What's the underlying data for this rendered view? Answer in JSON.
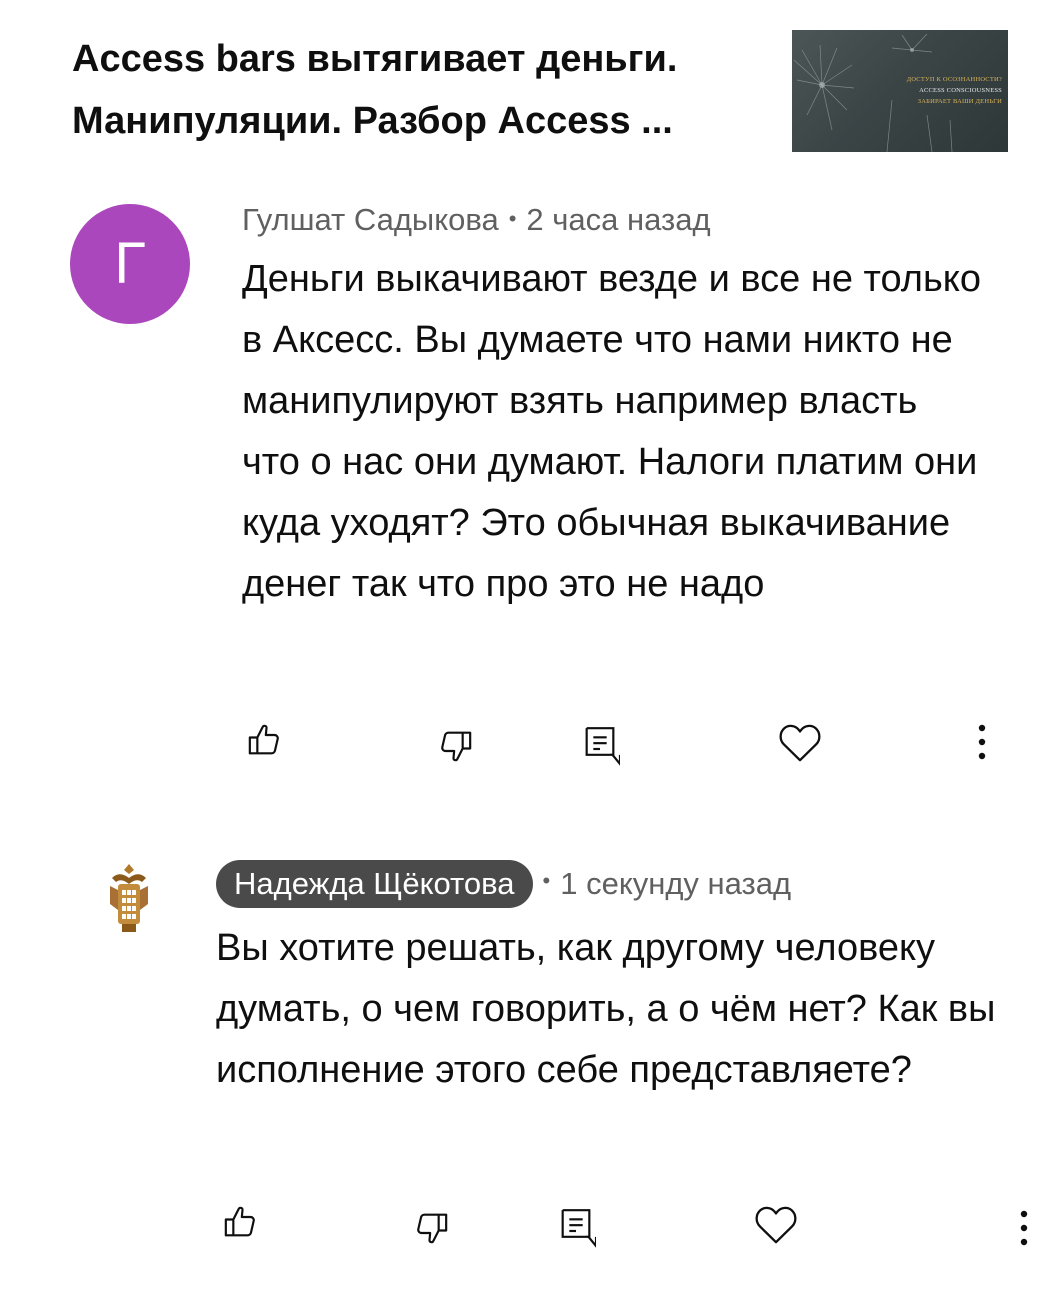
{
  "video": {
    "title": "Access bars вытягивает деньги. Манипуляции. Разбор Access ...",
    "thumbnail": {
      "line1": "ДОСТУП К ОСОЗНАННОСТИ?",
      "line2": "ACCESS CONSCIOUSNESS",
      "line3": "ЗАБИРАЕТ ВАШИ ДЕНЬГИ"
    }
  },
  "comments": [
    {
      "avatar_letter": "Г",
      "avatar_color": "#ab47bc",
      "author": "Гулшат Садыкова",
      "separator": "•",
      "time": "2 часа назад",
      "text": "Деньги выкачивают везде и все не только в Аксесс. Вы думаете что нами никто не манипулируют взять например власть что о нас они думают. Налоги платим они куда уходят? Это обычная выкачивание денег так что про это не надо"
    },
    {
      "avatar_icon": "emblem-avatar-icon",
      "author": "Надежда Щёкотова",
      "separator": "•",
      "time": "1 секунду назад",
      "text": "Вы хотите решать, как другому человеку думать, о чем говорить, а о чём нет? Как вы исполнение этого себе представляете?"
    }
  ],
  "actions": {
    "icons": [
      "thumb-up-icon",
      "thumb-down-icon",
      "reply-icon",
      "heart-icon",
      "more-vertical-icon"
    ]
  },
  "colors": {
    "text": "#0f0f0f",
    "meta": "#606060",
    "author_pill": "#4a4a4a",
    "avatar": "#ab47bc"
  }
}
